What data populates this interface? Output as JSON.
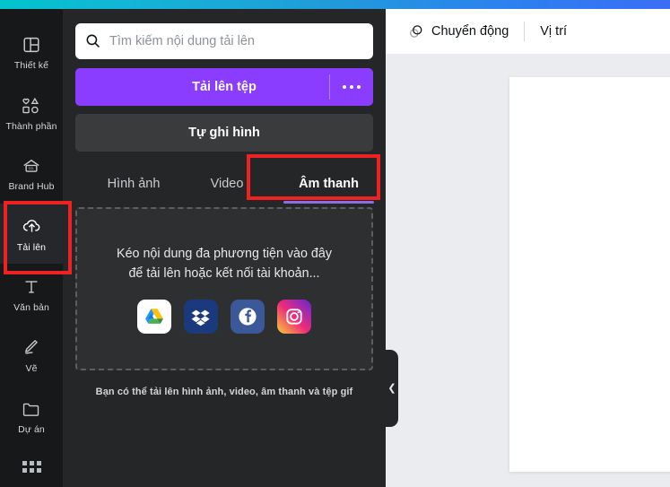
{
  "theme": {
    "accent_purple": "#8b3dff",
    "panel_bg": "#252627",
    "rail_bg": "#17181a",
    "annotation_red": "#ee2222",
    "tab_underline": "#8b6fe0",
    "gradient_from": "#00c4cc",
    "gradient_to": "#3b6ef5"
  },
  "rail": {
    "items": [
      {
        "label": "Thiết kế",
        "icon": "layout-icon",
        "name": "sidebar-item-design",
        "active": false
      },
      {
        "label": "Thành phần",
        "icon": "shapes-icon",
        "name": "sidebar-item-elements",
        "active": false
      },
      {
        "label": "Brand Hub",
        "icon": "brand-hub-icon",
        "name": "sidebar-item-brand-hub",
        "active": false
      },
      {
        "label": "Tải lên",
        "icon": "upload-icon",
        "name": "sidebar-item-uploads",
        "active": true
      },
      {
        "label": "Văn bản",
        "icon": "text-icon",
        "name": "sidebar-item-text",
        "active": false
      },
      {
        "label": "Vẽ",
        "icon": "draw-pen-icon",
        "name": "sidebar-item-draw",
        "active": false
      },
      {
        "label": "Dự án",
        "icon": "folder-icon",
        "name": "sidebar-item-projects",
        "active": false
      }
    ],
    "apps_icon": "apps-grid-icon"
  },
  "panel": {
    "search": {
      "placeholder": "Tìm kiếm nội dung tải lên",
      "value": "",
      "icon": "search-icon"
    },
    "upload_button": {
      "label": "Tải lên tệp",
      "more_icon": "more-horizontal-icon"
    },
    "record_button": {
      "label": "Tự ghi hình"
    },
    "tabs": [
      {
        "label": "Hình ảnh",
        "active": false
      },
      {
        "label": "Video",
        "active": false
      },
      {
        "label": "Âm thanh",
        "active": true
      }
    ],
    "dropzone": {
      "text": "Kéo nội dung đa phương tiện vào đây để tải lên hoặc kết nối tài khoản...",
      "services": [
        {
          "name": "google-drive-icon",
          "label": "Google Drive"
        },
        {
          "name": "dropbox-icon",
          "label": "Dropbox"
        },
        {
          "name": "facebook-icon",
          "label": "Facebook"
        },
        {
          "name": "instagram-icon",
          "label": "Instagram"
        }
      ]
    },
    "hint": "Bạn có thể tải lên hình ảnh, video, âm thanh và tệp gif"
  },
  "editor": {
    "toolbar": [
      {
        "label": "Chuyển động",
        "icon": "motion-circles-icon",
        "name": "toolbar-animate-button"
      },
      {
        "label": "Vị trí",
        "icon": null,
        "name": "toolbar-position-button"
      }
    ],
    "collapse_handle": {
      "icon": "chevron-left-icon"
    }
  }
}
